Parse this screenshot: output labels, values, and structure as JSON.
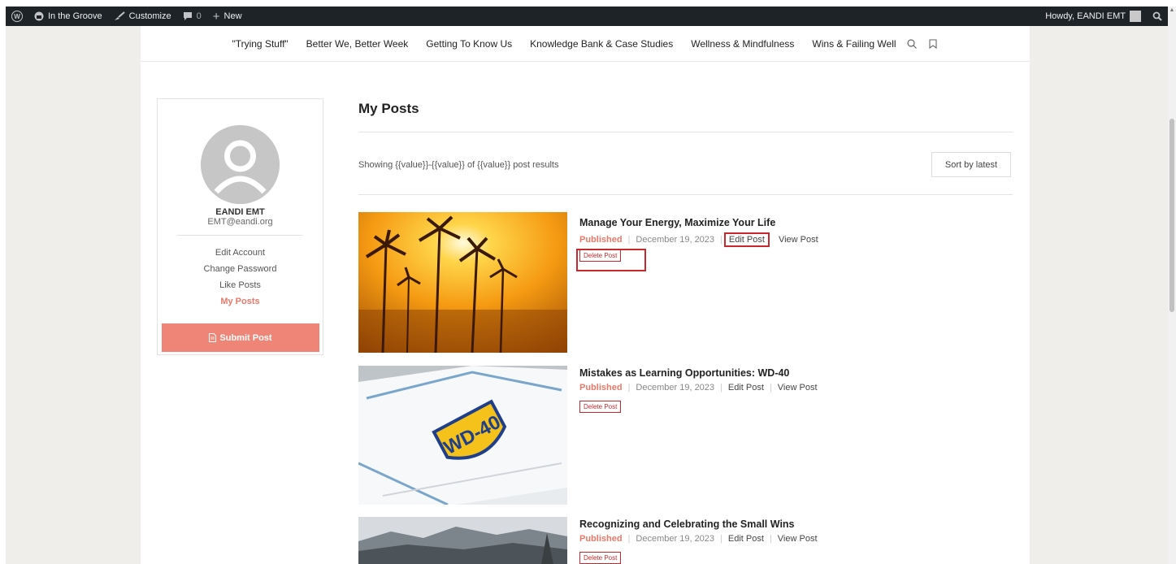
{
  "adminbar": {
    "site_name": "In the Groove",
    "customize": "Customize",
    "comments_count": "0",
    "new_label": "New",
    "howdy": "Howdy, EANDI EMT"
  },
  "nav": {
    "items": [
      "\"Trying Stuff\"",
      "Better We, Better Week",
      "Getting To Know Us",
      "Knowledge Bank & Case Studies",
      "Wellness & Mindfulness",
      "Wins & Failing Well"
    ]
  },
  "profile": {
    "name": "EANDI EMT",
    "email": "EMT@eandi.org",
    "menu": [
      "Edit Account",
      "Change Password",
      "Like Posts",
      "My Posts"
    ],
    "submit_label": "Submit Post"
  },
  "main": {
    "title": "My Posts",
    "showing": "Showing {{value}}-{{value}} of {{value}} post results",
    "sort_label": "Sort by latest"
  },
  "posts": [
    {
      "title": "Manage Your Energy, Maximize Your Life",
      "status": "Published",
      "date": "December 19, 2023",
      "edit_label": "Edit Post",
      "view_label": "View Post",
      "delete_label": "Delete Post",
      "image": "sunset-palm-trees"
    },
    {
      "title": "Mistakes as Learning Opportunities: WD-40",
      "status": "Published",
      "date": "December 19, 2023",
      "edit_label": "Edit Post",
      "view_label": "View Post",
      "delete_label": "Delete Post",
      "image": "wd-40-towel",
      "image_text": "WD-40"
    },
    {
      "title": "Recognizing and Celebrating the Small Wins",
      "status": "Published",
      "date": "December 19, 2023",
      "edit_label": "Edit Post",
      "view_label": "View Post",
      "delete_label": "Delete Post",
      "image": "mountain-landscape"
    }
  ],
  "colors": {
    "accent": "#ee8577",
    "highlight_box": "#c8282d",
    "adminbar": "#1d2327"
  }
}
